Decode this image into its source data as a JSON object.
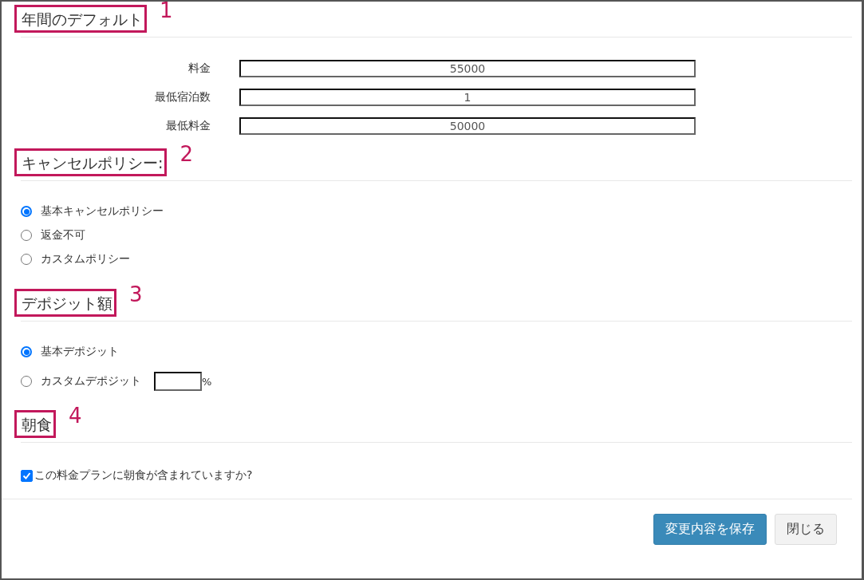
{
  "sections": [
    {
      "kind": "fields",
      "title": "年間のデフォルト",
      "number": "1",
      "fields": [
        {
          "label": "料金",
          "value": "55000"
        },
        {
          "label": "最低宿泊数",
          "value": "1"
        },
        {
          "label": "最低料金",
          "value": "50000"
        }
      ]
    },
    {
      "kind": "radios",
      "title": "キャンセルポリシー:",
      "number": "2",
      "options": [
        {
          "kind": "plain",
          "label": "基本キャンセルポリシー",
          "selected": true
        },
        {
          "kind": "plain",
          "label": "返金不可",
          "selected": false
        },
        {
          "kind": "plain",
          "label": "カスタムポリシー",
          "selected": false
        }
      ]
    },
    {
      "kind": "radios",
      "title": "デポジット額",
      "number": "3",
      "options": [
        {
          "kind": "plain",
          "label": "基本デポジット",
          "selected": true
        },
        {
          "kind": "percent",
          "label": "カスタムデポジット",
          "selected": false,
          "suffix": "%"
        }
      ]
    },
    {
      "kind": "checkbox",
      "title": "朝食",
      "number": "4",
      "checkbox": {
        "label": "この料金プランに朝食が含まれていますか?",
        "checked": true
      }
    }
  ],
  "buttons": [
    {
      "kind": "primary",
      "label": "変更内容を保存"
    },
    {
      "kind": "default",
      "label": "閉じる"
    }
  ]
}
